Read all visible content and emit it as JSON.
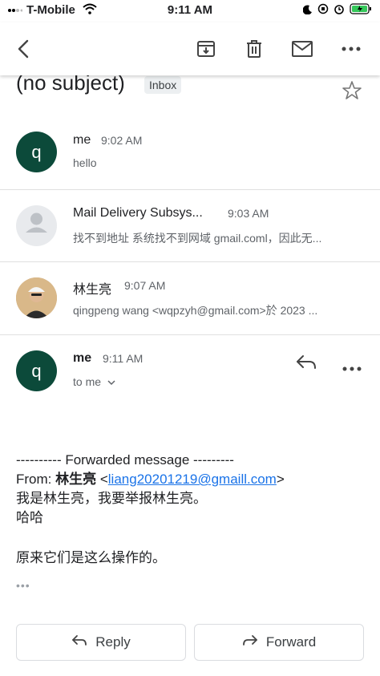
{
  "status_bar": {
    "carrier": "T-Mobile",
    "time": "9:11 AM"
  },
  "toolbar": {
    "back_icon": "back-arrow-icon",
    "archive_icon": "archive-icon",
    "delete_icon": "trash-icon",
    "mark_unread_icon": "mail-icon",
    "more_icon": "more-dots-icon"
  },
  "subject": {
    "title": "(no subject)",
    "label": "Inbox"
  },
  "messages": [
    {
      "sender": "me",
      "time": "9:02 AM",
      "snippet": "hello",
      "avatar_letter": "q",
      "avatar_color": "#0c4a3a"
    },
    {
      "sender": "Mail Delivery Subsys...",
      "time": "9:03 AM",
      "snippet": "找不到地址 系统找不到网域 gmail.coml，因此无...",
      "avatar_color": "#e8eaed"
    },
    {
      "sender": "林生亮",
      "time": "9:07 AM",
      "snippet": "qingpeng wang <wqpzyh@gmail.com>於 2023 ..."
    }
  ],
  "open_message": {
    "sender": "me",
    "time": "9:11 AM",
    "to": "to me",
    "avatar_letter": "q",
    "avatar_color": "#0c4a3a",
    "forward_header": "---------- Forwarded message ---------",
    "from_label": "From:",
    "from_name": "林生亮",
    "from_email": "liang20201219@gmaill.com",
    "line1": "我是林生亮，我要举报林生亮。",
    "line2": "哈哈",
    "line3": "原来它们是这么操作的。",
    "collapsed": "•••"
  },
  "actions": {
    "reply": "Reply",
    "forward": "Forward"
  },
  "colors": {
    "accent_link": "#1a73e8",
    "battery": "#34c759"
  }
}
